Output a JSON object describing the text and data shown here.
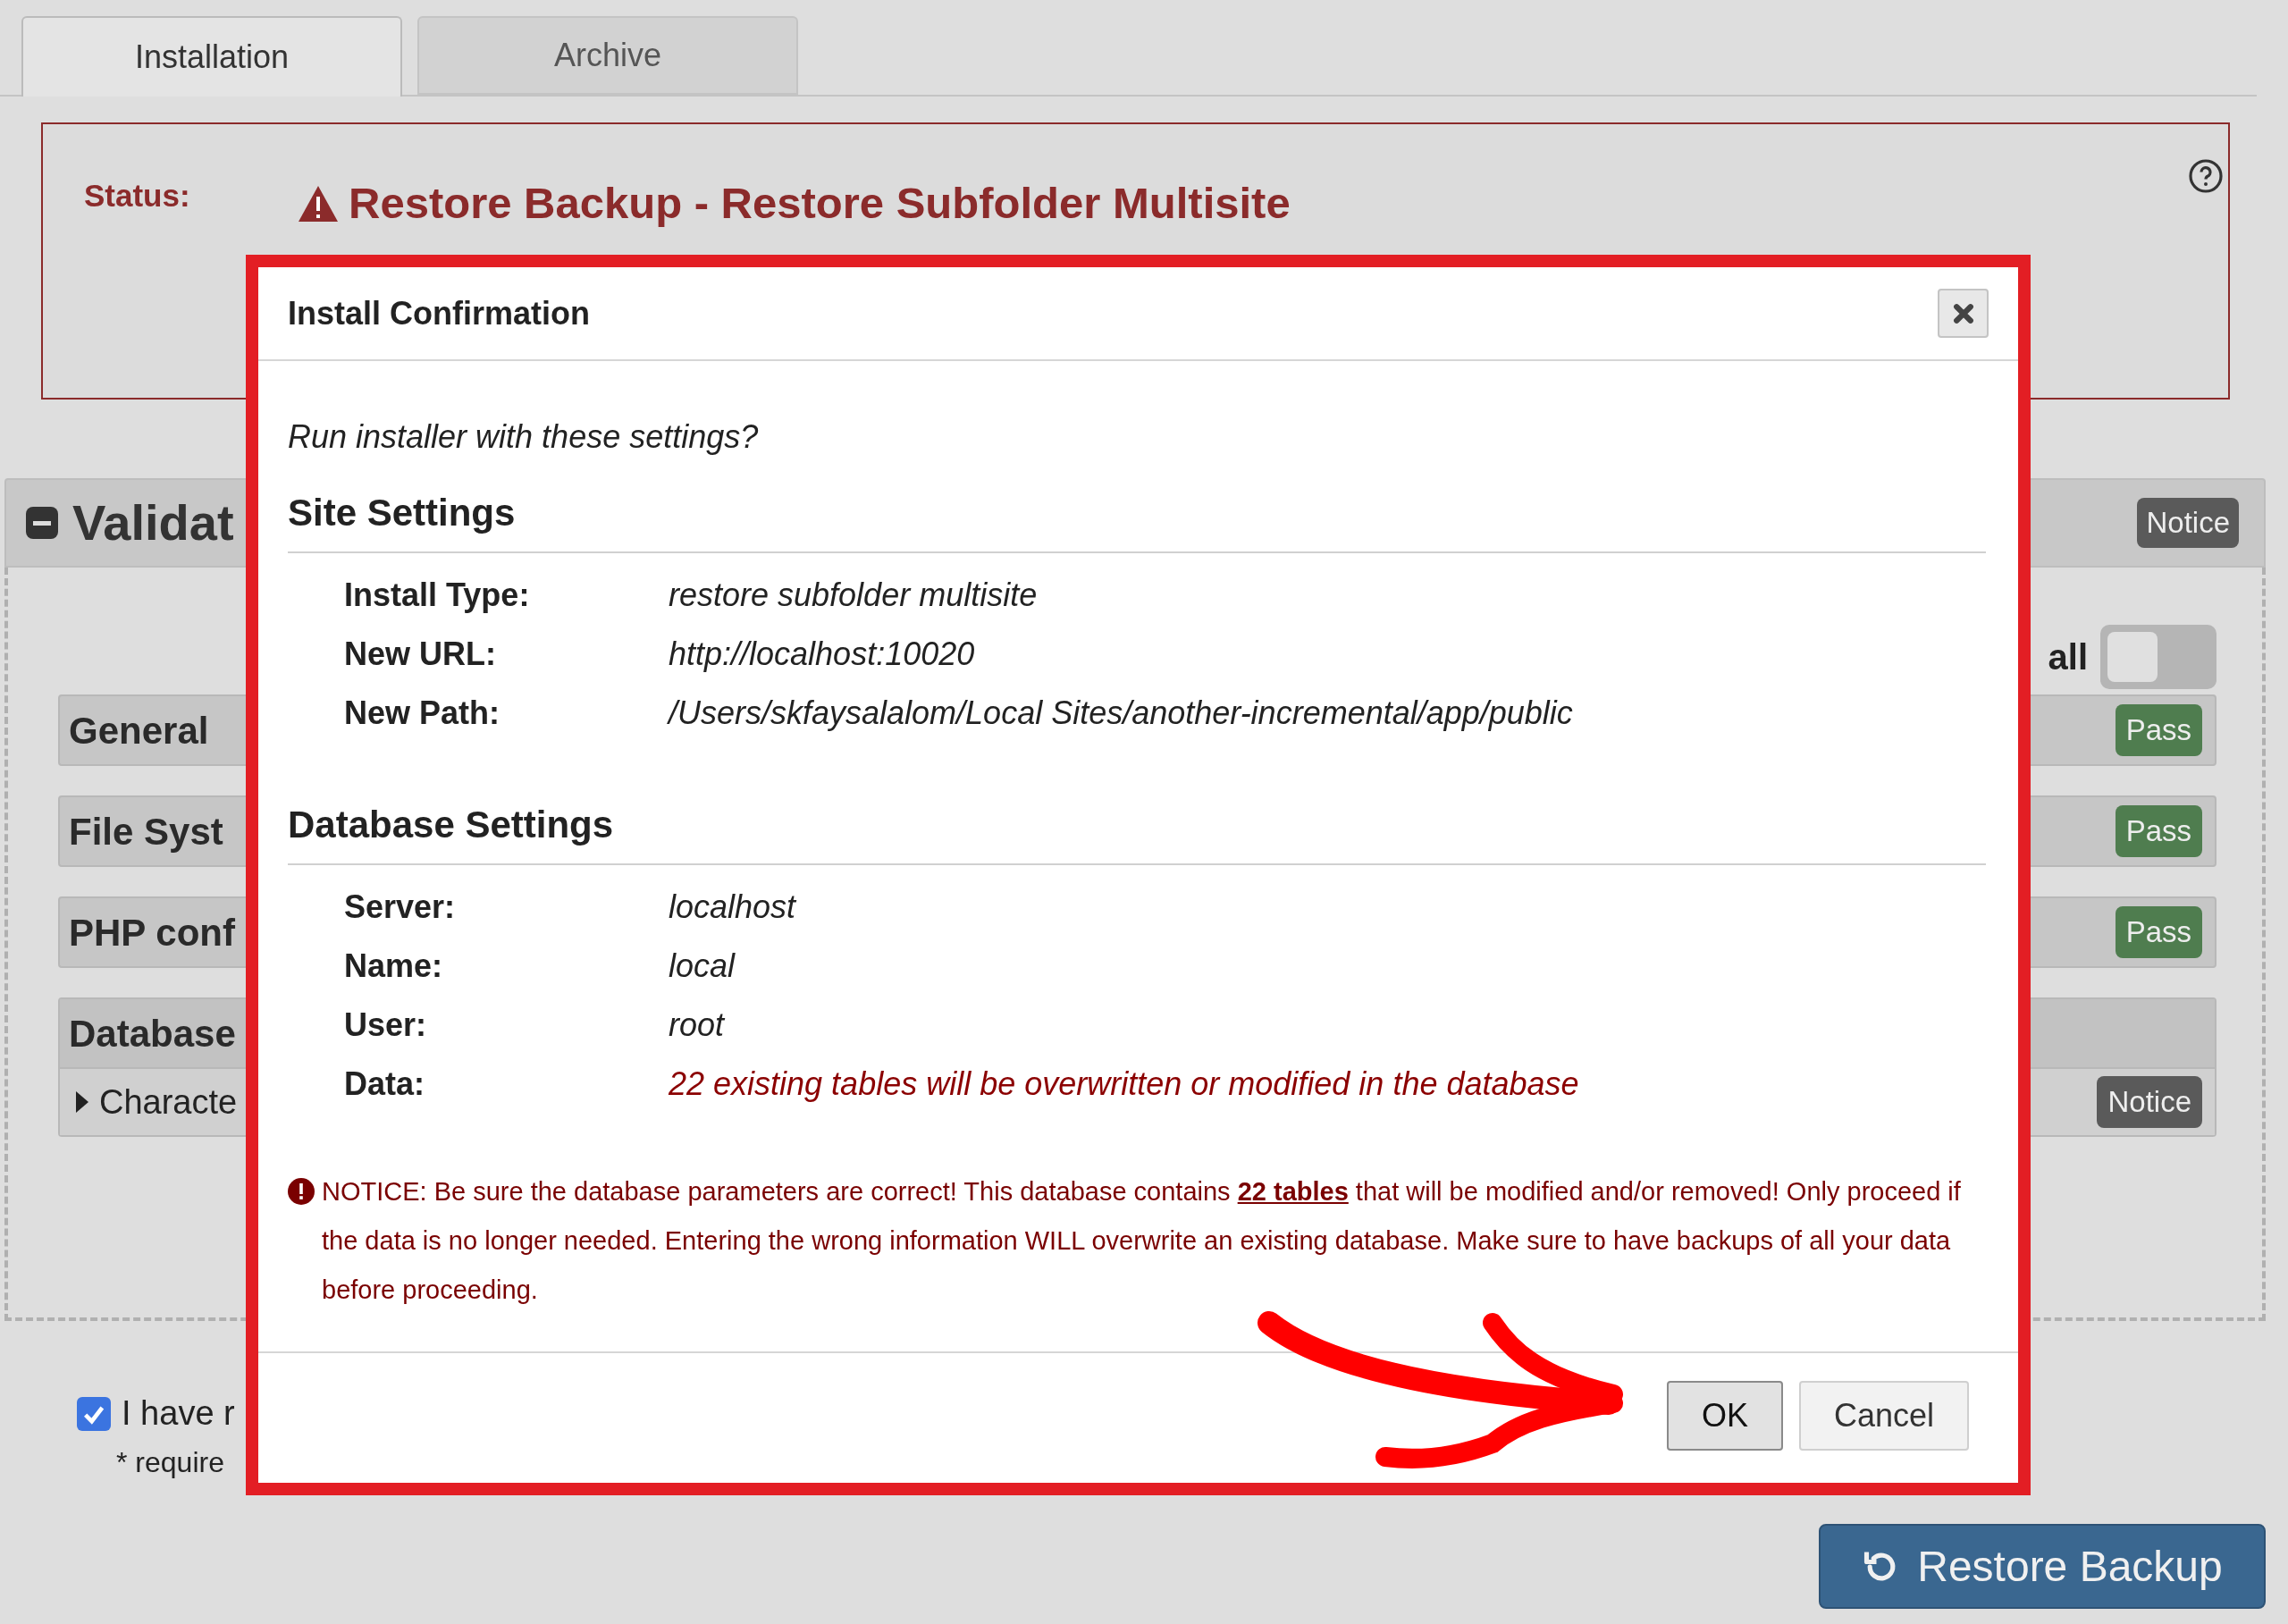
{
  "tabs": [
    {
      "label": "Installation",
      "selected": true
    },
    {
      "label": "Archive",
      "selected": false
    }
  ],
  "status": {
    "label": "Status:",
    "title": "Restore Backup - Restore Subfolder Multisite"
  },
  "validation": {
    "title": "Validat",
    "badge": "Notice",
    "toggle_label": "all",
    "toggle_on": false,
    "sections": [
      {
        "title": "General",
        "badge": "Pass",
        "kind": "pass"
      },
      {
        "title": "File Syst",
        "badge": "Pass",
        "kind": "pass"
      },
      {
        "title": "PHP conf",
        "badge": "Pass",
        "kind": "pass"
      },
      {
        "title": "Database",
        "kind": "group",
        "children": [
          {
            "label": "Characte",
            "badge": "Notice",
            "kind": "notice"
          }
        ]
      }
    ]
  },
  "agreement": {
    "checked": true,
    "label": "I have r",
    "note": "* require"
  },
  "restore_button": "Restore Backup",
  "dialog": {
    "title": "Install Confirmation",
    "question": "Run installer with these settings?",
    "groups": [
      {
        "heading": "Site Settings",
        "rows": [
          {
            "label": "Install Type:",
            "value": "restore subfolder multisite",
            "kind": "plain"
          },
          {
            "label": "New URL:",
            "value": "http://localhost:10020",
            "kind": "plain"
          },
          {
            "label": "New Path:",
            "value": "/Users/skfaysalalom/Local Sites/another-incremental/app/public",
            "kind": "plain"
          }
        ]
      },
      {
        "heading": "Database Settings",
        "rows": [
          {
            "label": "Server:",
            "value": "localhost",
            "kind": "plain"
          },
          {
            "label": "Name:",
            "value": "local",
            "kind": "plain"
          },
          {
            "label": "User:",
            "value": "root",
            "kind": "plain"
          },
          {
            "label": "Data:",
            "value": "22 existing tables will be overwritten or modified in the database",
            "kind": "warning"
          }
        ]
      }
    ],
    "notice": {
      "before": "NOTICE: Be sure the database parameters are correct! This database contains",
      "link": "22 tables",
      "after": "that will be modified and/or removed! Only proceed if the data is no longer needed. Entering the wrong information WILL overwrite an existing database. Make sure to have backups of all your data before proceeding."
    },
    "buttons": [
      {
        "label": "OK",
        "kind": "primary"
      },
      {
        "label": "Cancel",
        "kind": "secondary"
      }
    ]
  }
}
